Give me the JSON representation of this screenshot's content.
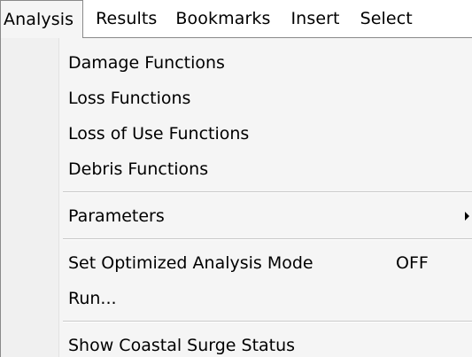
{
  "menubar": {
    "items": [
      {
        "label": "Analysis"
      },
      {
        "label": "Results"
      },
      {
        "label": "Bookmarks"
      },
      {
        "label": "Insert"
      },
      {
        "label": "Select"
      }
    ]
  },
  "analysis_menu": {
    "damage_functions": "Damage Functions",
    "loss_functions": "Loss Functions",
    "loss_of_use_functions": "Loss of Use Functions",
    "debris_functions": "Debris Functions",
    "parameters": "Parameters",
    "optimized_mode": {
      "label": "Set Optimized Analysis Mode",
      "value": "OFF"
    },
    "run": "Run...",
    "coastal_surge": "Show Coastal Surge Status"
  }
}
